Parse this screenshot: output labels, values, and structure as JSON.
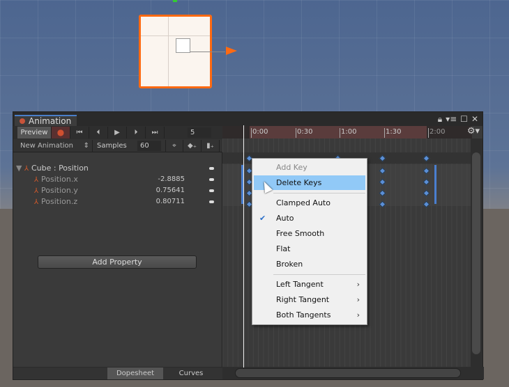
{
  "window": {
    "title": "Animation",
    "icons": [
      "lock-icon",
      "menu-icon",
      "maximize-icon",
      "close-icon"
    ]
  },
  "toolbar": {
    "preview": "Preview",
    "frame": "5",
    "clip": "New Animation",
    "samples_label": "Samples",
    "samples": "60"
  },
  "properties": {
    "group": "Cube : Position",
    "items": [
      {
        "name": "Position.x",
        "value": "-2.8885"
      },
      {
        "name": "Position.y",
        "value": "0.75641"
      },
      {
        "name": "Position.z",
        "value": "0.80711"
      }
    ],
    "add": "Add Property"
  },
  "bottom_tabs": {
    "dopesheet": "Dopesheet",
    "curves": "Curves"
  },
  "ruler": [
    "0:00",
    "0:30",
    "1:00",
    "1:30",
    "2:00"
  ],
  "menu": {
    "items": [
      "Add Key",
      "Delete Keys",
      "Clamped Auto",
      "Auto",
      "Free Smooth",
      "Flat",
      "Broken",
      "Left Tangent",
      "Right Tangent",
      "Both Tangents"
    ],
    "checked": "Auto",
    "highlighted": "Delete Keys"
  },
  "colors": {
    "accent": "#4a7fc9",
    "key": "#5b8fd6",
    "record": "#c8543a",
    "highlight": "#91c9f7"
  }
}
